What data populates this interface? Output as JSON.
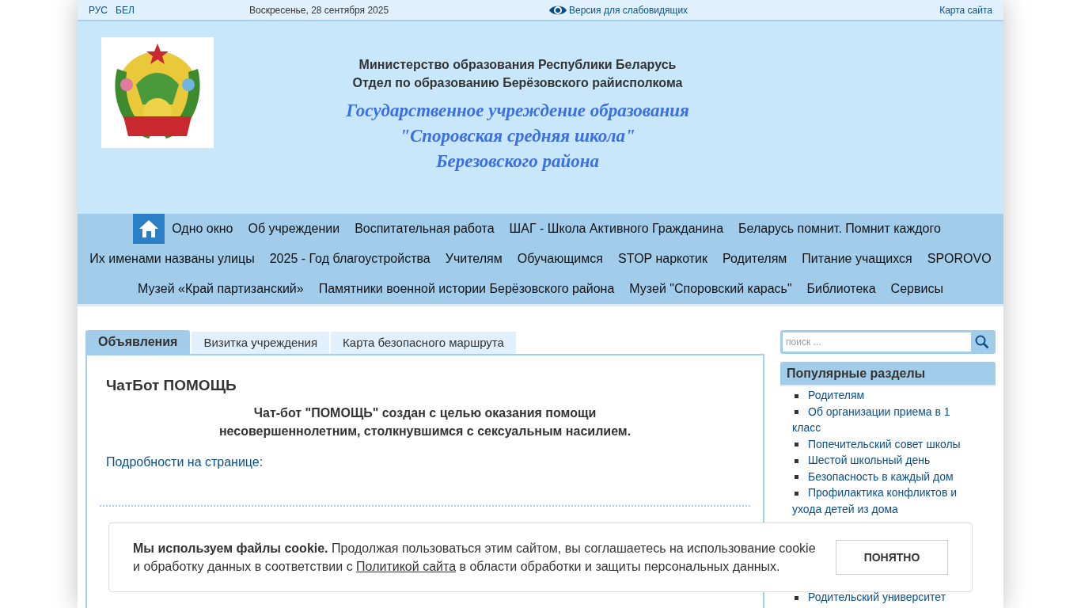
{
  "top_bar": {
    "languages": [
      "РУС",
      "БЕЛ"
    ],
    "date": "Воскресенье, 28 сентября 2025",
    "accessibility_link": "Версия для слабовидящих",
    "sitemap_link": "Карта сайта"
  },
  "header": {
    "ministry": "Министерство образования Республики Беларусь",
    "department": "Отдел по образованию Берёзовского райисполкома",
    "school_lines": [
      "Государственное учреждение образования",
      "\"Споровская средняя школа\"",
      "Березовского района"
    ]
  },
  "nav": {
    "items": [
      "Одно окно",
      "Об учреждении",
      "Воспитательная работа",
      "ШАГ - Школа Активного Гражданина",
      "Беларусь помнит. Помнит каждого",
      "Их именами названы улицы",
      "2025 - Год благоустройства",
      "Учителям",
      "Обучающимся",
      "STOP наркотик",
      "Родителям",
      "Питание учащихся",
      "SPOROVO",
      "Музей «Край партизанский»",
      "Памятники военной истории Берёзовского района",
      "Музей \"Споровский карась\"",
      "Библиотека",
      "Сервисы"
    ]
  },
  "tabs": [
    {
      "label": "Объявления",
      "selected": true
    },
    {
      "label": "Визитка учреждения",
      "selected": false
    },
    {
      "label": "Карта безопасного маршрута",
      "selected": false
    }
  ],
  "article": {
    "title": "ЧатБот ПОМОЩЬ",
    "lead": "Чат-бот \"ПОМОЩЬ\" создан с целью оказания помощи несовершеннолетним, столкнувшимся с сексуальным насилием.",
    "link": "Подробности на странице:"
  },
  "search": {
    "placeholder": "поиск ..."
  },
  "popular": {
    "title": "Популярные разделы",
    "items": [
      "Родителям",
      "Об организации приема в 1 класс",
      "Попечительский совет школы",
      "Шестой школьный день",
      "Безопасность в каждый дом",
      "Профилактика конфликтов и ухода детей из дома"
    ],
    "items_after_banner": [
      "Родительский университет"
    ]
  },
  "cookie_banner": {
    "text_before": "**Мы используем файлы cookie.** Продолжая пользоваться этим сайтом, вы соглашаетесь на использование cookie и обработку данных в соответствии с ",
    "link": "Политикой сайта",
    "text_after": " в области обработки и защиты персональных данных.",
    "button": "ПОНЯТНО"
  }
}
